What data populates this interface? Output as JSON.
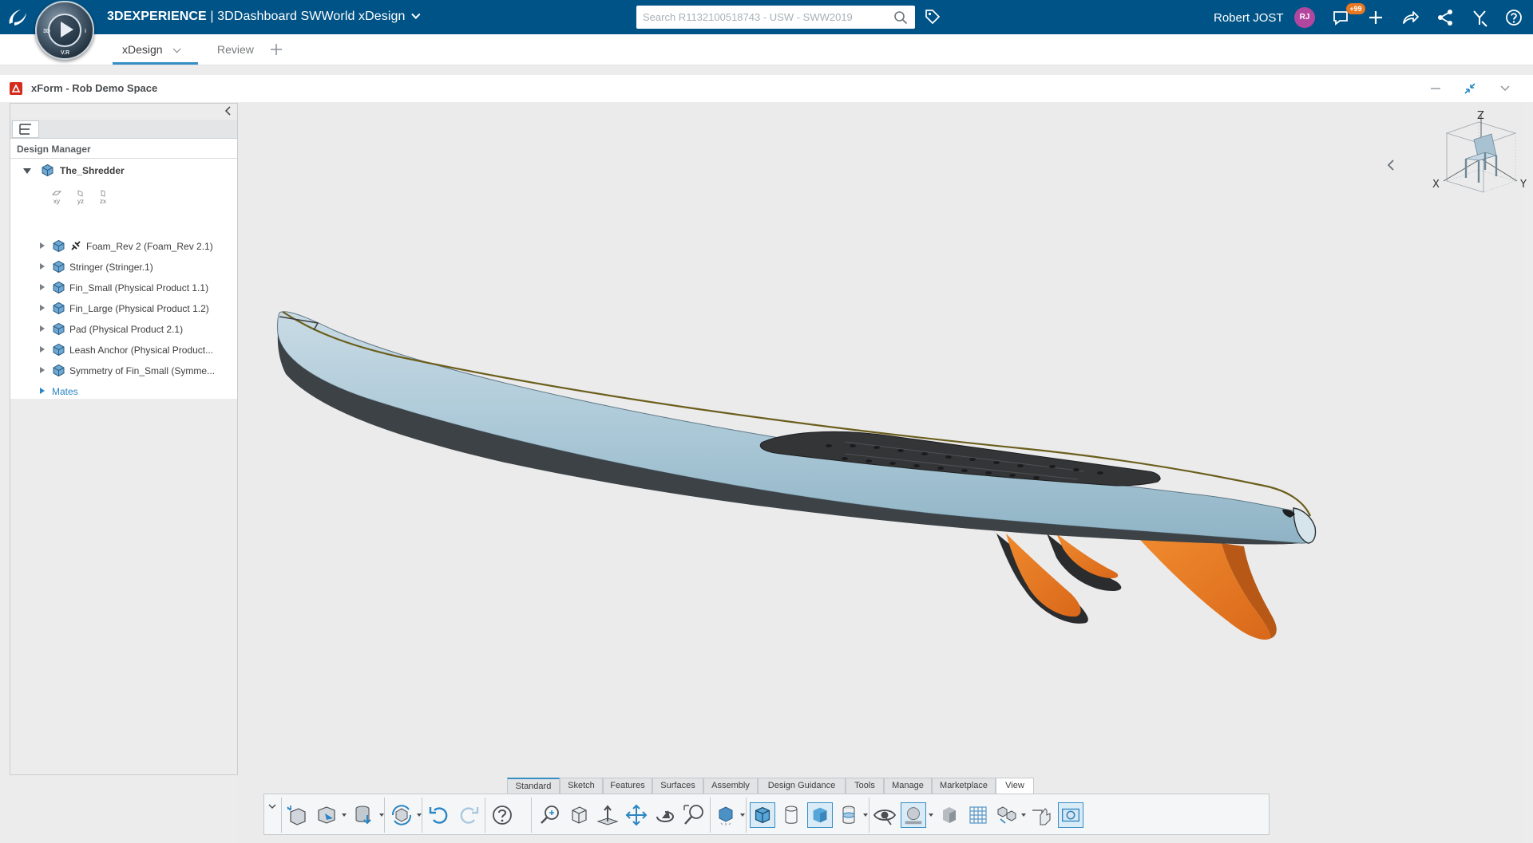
{
  "topbar": {
    "app_brand": "3DEXPERIENCE",
    "app_rest": " | 3DDashboard  SWWorld xDesign",
    "compass_labels": {
      "left": "3D",
      "right": "i",
      "bottom": "V.R"
    },
    "search_placeholder": "Search R1132100518743 - USW - SWW2019",
    "user_name": "Robert JOST",
    "user_initials": "RJ",
    "notification_count": "+99",
    "icons": [
      "3ds-logo",
      "compass",
      "search-icon",
      "tag-icon",
      "chat-icon",
      "plus-icon",
      "share-icon",
      "network-icon",
      "tools-icon",
      "help-icon"
    ],
    "colors": {
      "bar": "#005386",
      "avatar": "#b3479f",
      "badge": "#e87722"
    }
  },
  "tabs": [
    {
      "label": "xDesign",
      "active": true
    },
    {
      "label": "Review",
      "active": false
    }
  ],
  "widget": {
    "title": "xForm - Rob Demo Space"
  },
  "design_manager": {
    "title": "Design Manager",
    "root": "The_Shredder",
    "planes": [
      "xy",
      "yz",
      "zx"
    ],
    "items": [
      {
        "label": "Foam_Rev 2 (Foam_Rev 2.1)",
        "has_link_icon": true
      },
      {
        "label": "Stringer (Stringer.1)"
      },
      {
        "label": "Fin_Small (Physical Product 1.1)"
      },
      {
        "label": "Fin_Large (Physical Product 1.2)"
      },
      {
        "label": "Pad (Physical Product 2.1)"
      },
      {
        "label": "Leash Anchor (Physical Product..."
      },
      {
        "label": "Symmetry of Fin_Small (Symme..."
      }
    ],
    "mates_label": "Mates"
  },
  "viewcube": {
    "axes": {
      "z": "Z",
      "x": "X",
      "y": "Y"
    }
  },
  "command_tabs": [
    {
      "label": "Standard",
      "active": false
    },
    {
      "label": "Sketch",
      "active": false
    },
    {
      "label": "Features",
      "active": false
    },
    {
      "label": "Surfaces",
      "active": false
    },
    {
      "label": "Assembly",
      "active": false
    },
    {
      "label": "Design Guidance",
      "active": false
    },
    {
      "label": "Tools",
      "active": false
    },
    {
      "label": "Manage",
      "active": false
    },
    {
      "label": "Marketplace",
      "active": false
    },
    {
      "label": "View",
      "active": true
    }
  ],
  "command_icons": [
    "new-part-icon",
    "open-icon",
    "save-icon",
    "rebuild-icon",
    "undo-icon",
    "redo-icon",
    "help-icon",
    "zoom-fit-icon",
    "view-orientation-icon",
    "normal-to-icon",
    "pan-icon",
    "rotate-icon",
    "zoom-area-icon",
    "display-style-icon",
    "shaded-edges-icon",
    "transparent-icon",
    "shaded-icon",
    "section-icon",
    "visibility-icon",
    "ambient-occlusion-icon",
    "render-icon",
    "grid-icon",
    "explode-icon",
    "measure-icon",
    "capture-icon"
  ]
}
